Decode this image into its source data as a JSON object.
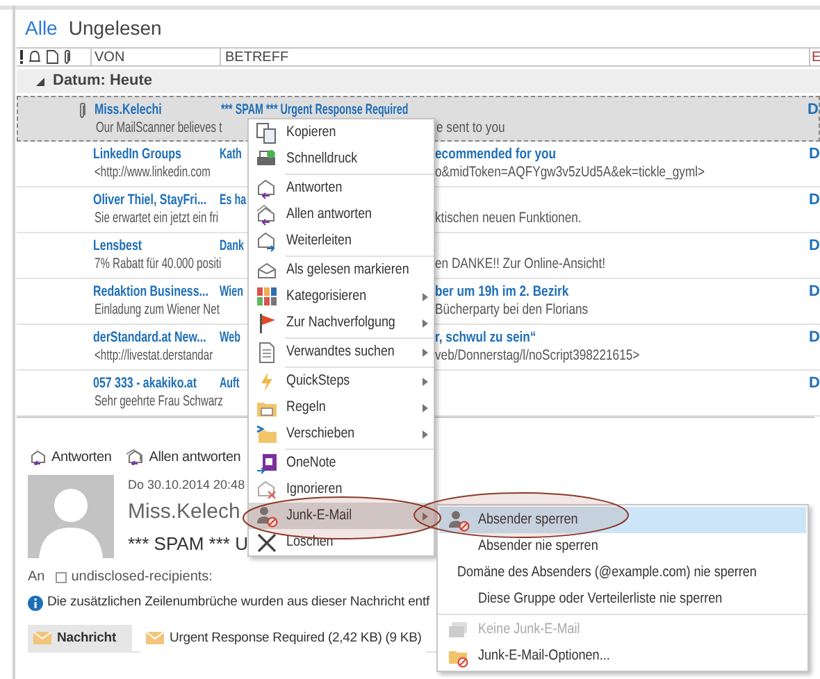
{
  "tabs": [
    {
      "label": "Alle",
      "selected": true
    },
    {
      "label": "Ungelesen",
      "selected": false
    }
  ],
  "columns": {
    "from": "VON",
    "subject": "BETREFF",
    "column_3": "E"
  },
  "group": {
    "label": "Datum: Heute",
    "expanded": true
  },
  "messages": [
    {
      "from": "Miss.Kelechi",
      "subject": "*** SPAM *** Urgent Response Required",
      "preview": "Our MailScanner believes t",
      "preview_tail": "e sent to you",
      "column_3": "D",
      "attachment": true,
      "selected": true
    },
    {
      "from": "LinkedIn Groups",
      "subject": "Kath",
      "subject_tail": "ecommended for you",
      "preview": "<http://www.linkedin.com",
      "preview_tail": "o&midToken=AQFYgw3v5zUd5A&ek=tickle_gyml>",
      "column_3": "D",
      "attachment": false,
      "selected": false
    },
    {
      "from": "Oliver Thiel, StayFri...",
      "subject": "Es ha",
      "preview": "Sie erwartet ein jetzt ein fri",
      "preview_tail": "ktischen neuen Funktionen.",
      "column_3": "D",
      "attachment": false,
      "selected": false
    },
    {
      "from": "Lensbest",
      "subject": "Dank",
      "preview": "7% Rabatt für 40.000 positi",
      "preview_tail": "en DANKE!! Zur Online-Ansicht!",
      "column_3": "D",
      "attachment": false,
      "selected": false
    },
    {
      "from": "Redaktion Business...",
      "subject": "Wien",
      "subject_tail": "ber um 19h im 2. Bezirk",
      "preview": "Einladung zum Wiener Net",
      "preview_tail": "Bücherparty bei den Florians",
      "column_3": "D",
      "attachment": false,
      "selected": false
    },
    {
      "from": "derStandard.at New...",
      "subject": "Web",
      "subject_tail": "r, schwul zu sein“",
      "preview": "<http://livestat.derstandar",
      "preview_tail": "veb/Donnerstag/l/noScript398221615>",
      "column_3": "D",
      "attachment": false,
      "selected": false
    },
    {
      "from": "057 333 - akakiko.at",
      "subject": "Auft",
      "preview": "Sehr geehrte Frau Schwarz",
      "column_3": "D",
      "attachment": false,
      "selected": false
    }
  ],
  "reading_pane": {
    "actions": [
      "Antworten",
      "Allen antworten"
    ],
    "date": "Do 30.10.2014 20:48",
    "sender": "Miss.Kelech",
    "subject": "*** SPAM *** U",
    "to_label": "An",
    "recipient": "undisclosed-recipients:",
    "recipient_checked": false,
    "info": "Die zusätzlichen Zeilenumbrüche wurden aus dieser Nachricht entf",
    "attachments": [
      {
        "label": "Nachricht",
        "selected": true
      },
      {
        "label": "Urgent Response Required (2,42 KB) (9 KB)",
        "selected": false
      }
    ]
  },
  "context_menu": {
    "items": [
      {
        "label": "Kopieren",
        "has_submenu": false,
        "selected": false
      },
      {
        "label": "Schnelldruck",
        "has_submenu": false,
        "selected": false,
        "separator_after": true
      },
      {
        "label": "Antworten",
        "has_submenu": false,
        "selected": false
      },
      {
        "label": "Allen antworten",
        "has_submenu": false,
        "selected": false
      },
      {
        "label": "Weiterleiten",
        "has_submenu": false,
        "selected": false,
        "separator_after": true
      },
      {
        "label": "Als gelesen markieren",
        "has_submenu": false,
        "selected": false
      },
      {
        "label": "Kategorisieren",
        "has_submenu": true,
        "selected": false
      },
      {
        "label": "Zur Nachverfolgung",
        "has_submenu": true,
        "selected": false,
        "separator_after": true
      },
      {
        "label": "Verwandtes suchen",
        "has_submenu": true,
        "selected": false,
        "separator_after": true
      },
      {
        "label": "QuickSteps",
        "has_submenu": true,
        "selected": false
      },
      {
        "label": "Regeln",
        "has_submenu": true,
        "selected": false
      },
      {
        "label": "Verschieben",
        "has_submenu": true,
        "selected": false,
        "separator_after": true
      },
      {
        "label": "OneNote",
        "has_submenu": false,
        "selected": false
      },
      {
        "label": "Ignorieren",
        "has_submenu": false,
        "selected": false
      },
      {
        "label": "Junk-E-Mail",
        "has_submenu": true,
        "selected": true
      },
      {
        "label": "Löschen",
        "has_submenu": false,
        "selected": false
      }
    ]
  },
  "submenu": {
    "items": [
      {
        "label": "Absender sperren",
        "selected": true,
        "disabled": false
      },
      {
        "label": "Absender nie sperren",
        "selected": false,
        "disabled": false
      },
      {
        "label": "Domäne des Absenders (@example.com) nie sperren",
        "selected": false,
        "disabled": false
      },
      {
        "label": "Diese Gruppe oder Verteilerliste nie sperren",
        "selected": false,
        "disabled": false,
        "separator_after": true
      },
      {
        "label": "Keine Junk-E-Mail",
        "selected": false,
        "disabled": true
      },
      {
        "label": "Junk-E-Mail-Optionen...",
        "selected": false,
        "disabled": false
      }
    ]
  }
}
